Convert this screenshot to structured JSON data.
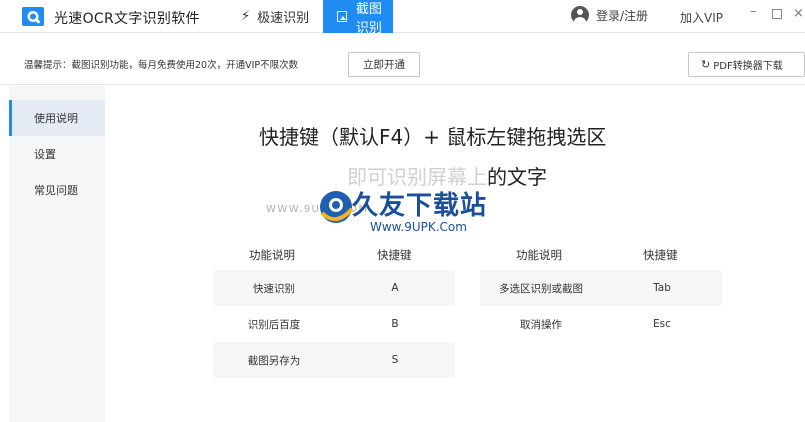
{
  "titlebar": {
    "app_title": "光速OCR文字识别软件",
    "tabs": [
      {
        "label": "极速识别",
        "icon": "lightning-icon"
      },
      {
        "label": "截图识别",
        "icon": "picture-icon",
        "active": true
      }
    ],
    "login_label": "登录/注册",
    "vip_label": "加入VIP",
    "window_controls": {
      "minimize": "–",
      "close": "×"
    }
  },
  "notice": {
    "text": "温馨提示：截图识别功能，每月免费使用20次，开通VIP不限次数",
    "open_button": "立即开通",
    "pdf_button": "PDF转换器下载"
  },
  "sidebar": {
    "items": [
      {
        "label": "使用说明",
        "active": true
      },
      {
        "label": "设置"
      },
      {
        "label": "常见问题"
      }
    ]
  },
  "main": {
    "headline": "快捷键（默认F4）+ 鼠标左键拖拽选区",
    "subline_faded": "即可识别屏幕上",
    "subline_rest": "的文字"
  },
  "watermark": {
    "text": "久友下载站",
    "url": "Www.9UPK.Com",
    "www": "WWW.9UPK.COM"
  },
  "shortcuts": {
    "headers": {
      "function": "功能说明",
      "key": "快捷键"
    },
    "left": [
      {
        "function": "快速识别",
        "key": "A"
      },
      {
        "function": "识别后百度",
        "key": "B"
      },
      {
        "function": "截图另存为",
        "key": "S"
      }
    ],
    "right": [
      {
        "function": "多选区识别或截图",
        "key": "Tab"
      },
      {
        "function": "取消操作",
        "key": "Esc"
      }
    ]
  },
  "colors": {
    "accent": "#1f8cf2",
    "sidebar_bg": "#f5f6f8",
    "row_shade": "#f5f6f8"
  }
}
